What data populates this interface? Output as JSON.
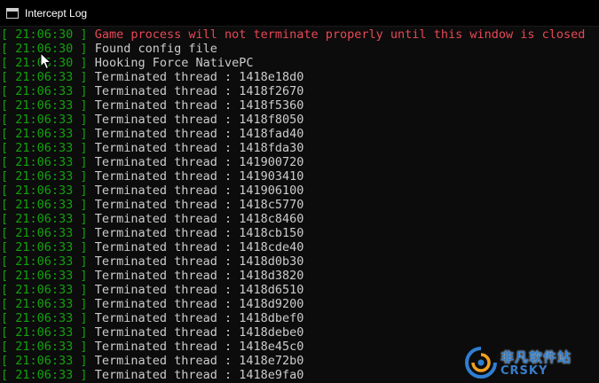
{
  "window": {
    "title": "Intercept Log"
  },
  "log": [
    {
      "time": "21:06:30",
      "message": "Game process will not terminate properly until this window is closed",
      "level": "warning"
    },
    {
      "time": "21:06:30",
      "message": "Found config file",
      "level": "info"
    },
    {
      "time": "21:06:30",
      "message": "Hooking Force NativePC",
      "level": "info"
    },
    {
      "time": "21:06:33",
      "message": "Terminated thread : 1418e18d0",
      "level": "info"
    },
    {
      "time": "21:06:33",
      "message": "Terminated thread : 1418f2670",
      "level": "info"
    },
    {
      "time": "21:06:33",
      "message": "Terminated thread : 1418f5360",
      "level": "info"
    },
    {
      "time": "21:06:33",
      "message": "Terminated thread : 1418f8050",
      "level": "info"
    },
    {
      "time": "21:06:33",
      "message": "Terminated thread : 1418fad40",
      "level": "info"
    },
    {
      "time": "21:06:33",
      "message": "Terminated thread : 1418fda30",
      "level": "info"
    },
    {
      "time": "21:06:33",
      "message": "Terminated thread : 141900720",
      "level": "info"
    },
    {
      "time": "21:06:33",
      "message": "Terminated thread : 141903410",
      "level": "info"
    },
    {
      "time": "21:06:33",
      "message": "Terminated thread : 141906100",
      "level": "info"
    },
    {
      "time": "21:06:33",
      "message": "Terminated thread : 1418c5770",
      "level": "info"
    },
    {
      "time": "21:06:33",
      "message": "Terminated thread : 1418c8460",
      "level": "info"
    },
    {
      "time": "21:06:33",
      "message": "Terminated thread : 1418cb150",
      "level": "info"
    },
    {
      "time": "21:06:33",
      "message": "Terminated thread : 1418cde40",
      "level": "info"
    },
    {
      "time": "21:06:33",
      "message": "Terminated thread : 1418d0b30",
      "level": "info"
    },
    {
      "time": "21:06:33",
      "message": "Terminated thread : 1418d3820",
      "level": "info"
    },
    {
      "time": "21:06:33",
      "message": "Terminated thread : 1418d6510",
      "level": "info"
    },
    {
      "time": "21:06:33",
      "message": "Terminated thread : 1418d9200",
      "level": "info"
    },
    {
      "time": "21:06:33",
      "message": "Terminated thread : 1418dbef0",
      "level": "info"
    },
    {
      "time": "21:06:33",
      "message": "Terminated thread : 1418debe0",
      "level": "info"
    },
    {
      "time": "21:06:33",
      "message": "Terminated thread : 1418e45c0",
      "level": "info"
    },
    {
      "time": "21:06:33",
      "message": "Terminated thread : 1418e72b0",
      "level": "info"
    },
    {
      "time": "21:06:33",
      "message": "Terminated thread : 1418e9fa0",
      "level": "info"
    }
  ],
  "watermark": {
    "text_cn": "非凡软件站",
    "text_en": "CRSKY"
  },
  "colors": {
    "timestamp": "#13a10e",
    "message": "#cccccc",
    "warning": "#e74856",
    "background": "#0c0c0c"
  },
  "icons": {
    "app": "console-window-icon",
    "cursor": "mouse-pointer-icon"
  }
}
